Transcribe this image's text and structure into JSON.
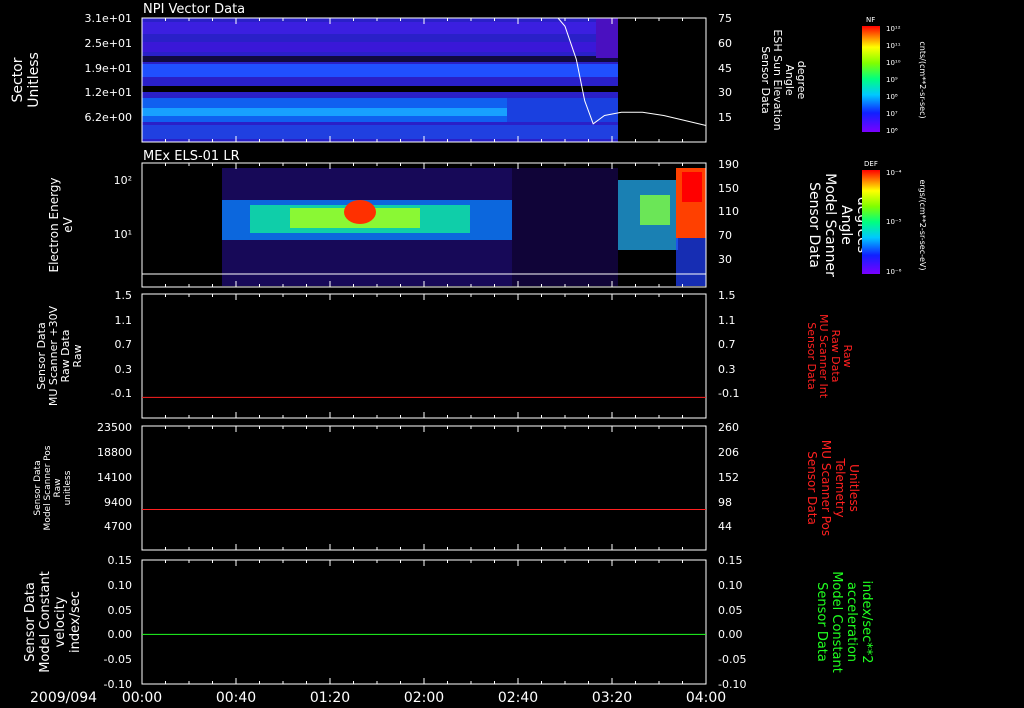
{
  "date_label": "2009/094",
  "time_ticks": [
    "00:00",
    "00:40",
    "01:20",
    "02:00",
    "02:40",
    "03:20",
    "04:00"
  ],
  "panels": [
    {
      "title": "NPI Vector Data",
      "left_label": [
        "Sector",
        "Unitless"
      ],
      "left_ticks": [
        "3.1e+01",
        "2.5e+01",
        "1.9e+01",
        "1.2e+01",
        "6.2e+00"
      ],
      "right_label": [
        "Sensor Data",
        "ESH Sun Elevation",
        "Angle",
        "degree"
      ],
      "right_ticks": [
        "75",
        "60",
        "45",
        "30",
        "15"
      ],
      "colorbar": {
        "name": "NF",
        "unit": "cnts/(cm**2-sr-sec)",
        "ticks": [
          "10¹²",
          "10¹¹",
          "10¹⁰",
          "10⁹",
          "10⁸",
          "10⁷",
          "10⁶"
        ]
      }
    },
    {
      "title": "MEx ELS-01 LR",
      "left_label": [
        "Electron Energy",
        "eV"
      ],
      "left_ticks": [
        "10²",
        "10¹"
      ],
      "right_label": [
        "Sensor Data",
        "Model Scanner",
        "Angle",
        "degrees"
      ],
      "right_ticks": [
        "190",
        "150",
        "110",
        "70",
        "30"
      ],
      "colorbar": {
        "name": "DEF",
        "unit": "ergs/(cm**2-sr-sec-eV)",
        "ticks": [
          "10⁻⁴",
          "10⁻⁵",
          "10⁻⁶"
        ]
      }
    },
    {
      "left_label": [
        "Sensor Data",
        "MU Scanner +30V",
        "Raw Data",
        "Raw"
      ],
      "left_ticks": [
        "1.5",
        "1.1",
        "0.7",
        "0.3",
        "-0.1"
      ],
      "right_label": [
        "Sensor Data",
        "MU Scanner Int",
        "Raw Data",
        "Raw"
      ],
      "right_ticks": [
        "1.5",
        "1.1",
        "0.7",
        "0.3",
        "-0.1"
      ],
      "right_label_color": "#ff2020"
    },
    {
      "left_label": [
        "Sensor Data",
        "Model Scanner Pos",
        "Raw",
        "unitless"
      ],
      "left_ticks": [
        "23500",
        "18800",
        "14100",
        "9400",
        "4700"
      ],
      "right_label": [
        "Sensor Data",
        "MU Scanner Pos",
        "Telemetry",
        "Unitless"
      ],
      "right_ticks": [
        "260",
        "206",
        "152",
        "98",
        "44"
      ],
      "right_label_color": "#ff2020"
    },
    {
      "left_label": [
        "Sensor Data",
        "Model Constant",
        "velocity",
        "index/sec"
      ],
      "left_ticks": [
        "0.15",
        "0.10",
        "0.05",
        "0.00",
        "-0.05",
        "-0.10"
      ],
      "right_label": [
        "Sensor Data",
        "Model Constant",
        "acceleration",
        "index/sec**2"
      ],
      "right_ticks": [
        "0.15",
        "0.10",
        "0.05",
        "0.00",
        "-0.05",
        "-0.10"
      ],
      "right_label_color": "#20ff20"
    }
  ],
  "chart_data": [
    {
      "type": "heatmap",
      "title": "NPI Vector Data",
      "xlabel": "2009/094",
      "ylabel": "Sector Unitless",
      "x_range": [
        "00:00",
        "04:00"
      ],
      "overlay_line": {
        "name": "ESH Sun Elevation Angle",
        "color": "#ffffff",
        "x_hours": [
          2.95,
          3.0,
          3.08,
          3.14,
          3.2,
          3.28,
          3.4,
          3.55,
          3.7,
          3.85,
          4.0
        ],
        "y": [
          75,
          70,
          50,
          25,
          11,
          16,
          18,
          18,
          16,
          13,
          10
        ],
        "ylim": [
          0,
          75
        ]
      }
    },
    {
      "type": "heatmap",
      "title": "MEx ELS-01 LR",
      "ylabel": "Electron Energy eV",
      "ylim": [
        1,
        190
      ],
      "overlay_line": {
        "name": "Model Scanner Angle",
        "color": "#ffffff",
        "x_hours": [
          0,
          4
        ],
        "y": [
          6,
          6
        ],
        "ylim": [
          0,
          190
        ]
      }
    },
    {
      "type": "line",
      "series": [
        {
          "name": "MU Scanner Int Raw Data",
          "color": "#ff2020",
          "x_hours": [
            0,
            4
          ],
          "y": [
            0.0,
            0.0
          ]
        }
      ],
      "ylim": [
        -0.3,
        1.5
      ]
    },
    {
      "type": "line",
      "series": [
        {
          "name": "MU Scanner Pos Telemetry",
          "color": "#ff2020",
          "x_hours": [
            0,
            4
          ],
          "y": [
            85,
            85
          ]
        }
      ],
      "ylim": [
        0,
        260
      ]
    },
    {
      "type": "line",
      "series": [
        {
          "name": "Model Constant acceleration",
          "color": "#20ff20",
          "x_hours": [
            0,
            4
          ],
          "y": [
            0.0,
            0.0
          ]
        }
      ],
      "ylim": [
        -0.1,
        0.15
      ]
    }
  ]
}
